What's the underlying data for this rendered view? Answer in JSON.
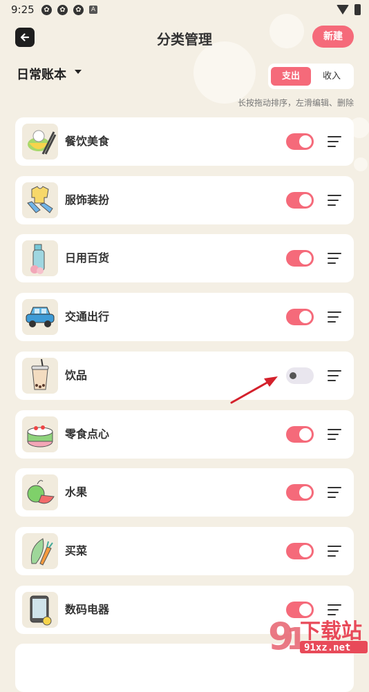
{
  "status_bar": {
    "time": "9:25"
  },
  "header": {
    "back_icon": "back-arrow-icon",
    "title": "分类管理",
    "new_button": "新建"
  },
  "book": {
    "name": "日常账本"
  },
  "type_toggle": {
    "expense": "支出",
    "income": "收入",
    "selected": "expense"
  },
  "hint": "长按拖动排序，左滑编辑、删除",
  "categories": [
    {
      "label": "餐饮美食",
      "icon": "rice-bowl-icon",
      "enabled": true
    },
    {
      "label": "服饰装扮",
      "icon": "clothing-icon",
      "enabled": true
    },
    {
      "label": "日用百货",
      "icon": "daily-goods-icon",
      "enabled": true
    },
    {
      "label": "交通出行",
      "icon": "car-icon",
      "enabled": true
    },
    {
      "label": "饮品",
      "icon": "bubble-tea-icon",
      "enabled": false
    },
    {
      "label": "零食点心",
      "icon": "cake-icon",
      "enabled": true
    },
    {
      "label": "水果",
      "icon": "fruit-icon",
      "enabled": true
    },
    {
      "label": "买菜",
      "icon": "vegetable-icon",
      "enabled": true
    },
    {
      "label": "数码电器",
      "icon": "phone-icon",
      "enabled": true
    }
  ],
  "colors": {
    "accent": "#f56a7a",
    "background": "#f4efe4",
    "toggle_off": "#e9e6ee"
  },
  "watermark": {
    "text": "下载站",
    "sub": "91xz.net"
  }
}
